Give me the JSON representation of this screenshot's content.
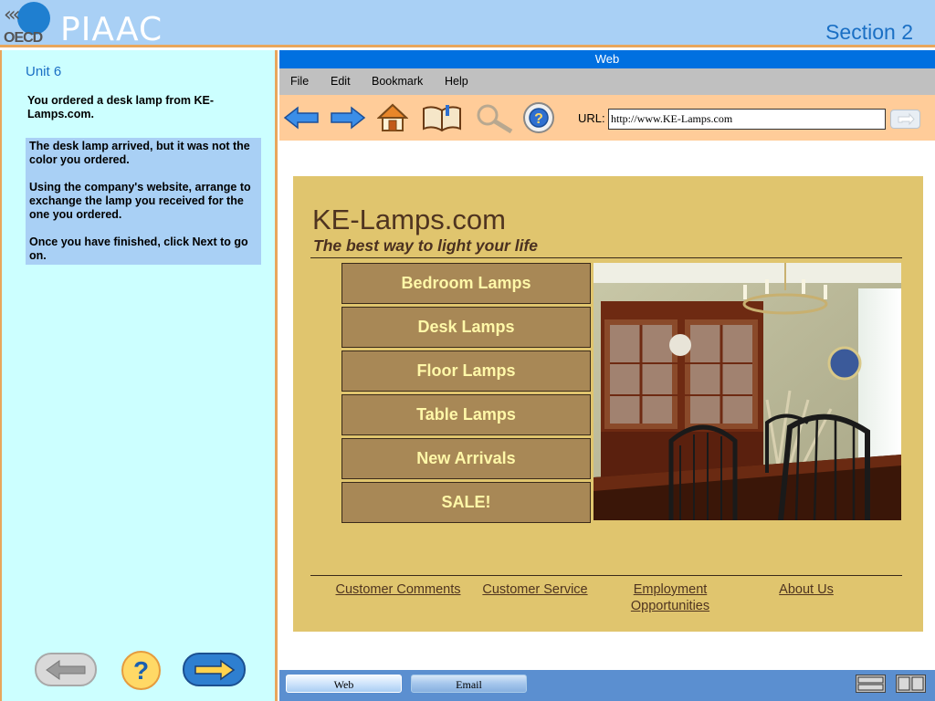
{
  "header": {
    "oecd_text": "OECD",
    "app_title": "PIAAC",
    "section": "Section 2"
  },
  "left_panel": {
    "unit": "Unit 6",
    "intro": "You ordered a desk lamp from KE-Lamps.com.",
    "task_paragraphs": [
      "The desk lamp arrived, but it was not the color you ordered.",
      "Using the company's website,  arrange to exchange the lamp you received for the one you ordered.",
      "Once you have finished, click Next to go on."
    ],
    "help_symbol": "?",
    "nav_icons": {
      "back": "left-arrow-icon",
      "help": "question-icon",
      "next": "right-arrow-icon"
    }
  },
  "browser": {
    "title": "Web",
    "menu": [
      "File",
      "Edit",
      "Bookmark",
      "Help"
    ],
    "toolbar_icons": [
      "back-arrow-icon",
      "forward-arrow-icon",
      "home-icon",
      "bookmarks-book-icon",
      "search-magnifier-icon",
      "help-lifebuoy-icon"
    ],
    "url_label": "URL:",
    "url_value": "http://www.KE-Lamps.com",
    "go_icon": "go-arrow-icon",
    "tabs": [
      "Web",
      "Email"
    ]
  },
  "site": {
    "title": "KE-Lamps.com",
    "tagline": "The best way to light your life",
    "categories": [
      "Bedroom Lamps",
      "Desk Lamps",
      "Floor Lamps",
      "Table Lamps",
      "New Arrivals",
      "SALE!"
    ],
    "footer_links": [
      "Customer Comments",
      "Customer Service",
      "Employment Opportunities",
      "About Us"
    ],
    "photo": "dining-room-photo",
    "colors": {
      "site_background": "#e0c56e",
      "button_background": "#a88856",
      "button_text": "#fff8a8",
      "title_text": "#4f3420"
    }
  },
  "theme": {
    "header_background": "#a9d0f5",
    "left_panel_background": "#ccffff",
    "task_box_background": "#a9d0f5",
    "accent_border": "#e8a65c",
    "title_bar": "#0070e0",
    "toolbar": "#ffcc99",
    "status_bar": "#5b8fd0"
  }
}
